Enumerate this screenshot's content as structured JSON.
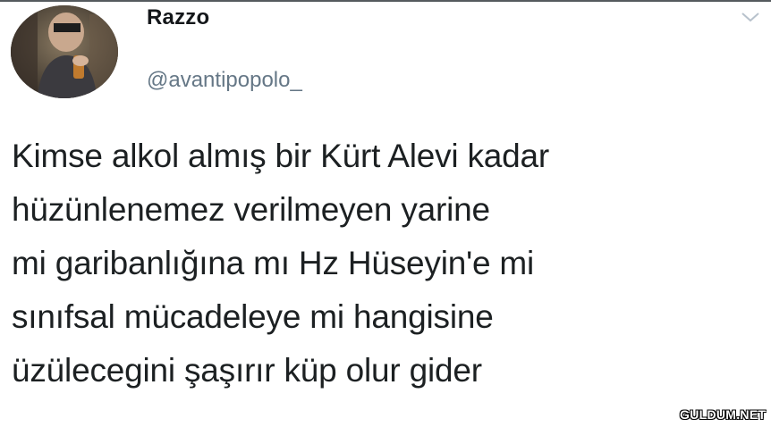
{
  "tweet": {
    "author": {
      "display_name": "Razzo",
      "handle": "@avantipopolo_",
      "avatar": "profile-photo"
    },
    "menu_icon": "chevron-down-icon",
    "text_lines": [
      "Kimse alkol almış bir Kürt Alevi kadar",
      "hüzünlenemez verilmeyen yarine",
      "mi garibanlığına mı Hz Hüseyin'e mi",
      "sınıfsal mücadeleye mi hangisine",
      "üzülecegini şaşırır küp olur gider"
    ]
  },
  "watermark": "GULDUM.NET",
  "colors": {
    "name": "#14171a",
    "handle": "#657786",
    "text": "#1c2022",
    "background": "#ffffff"
  }
}
